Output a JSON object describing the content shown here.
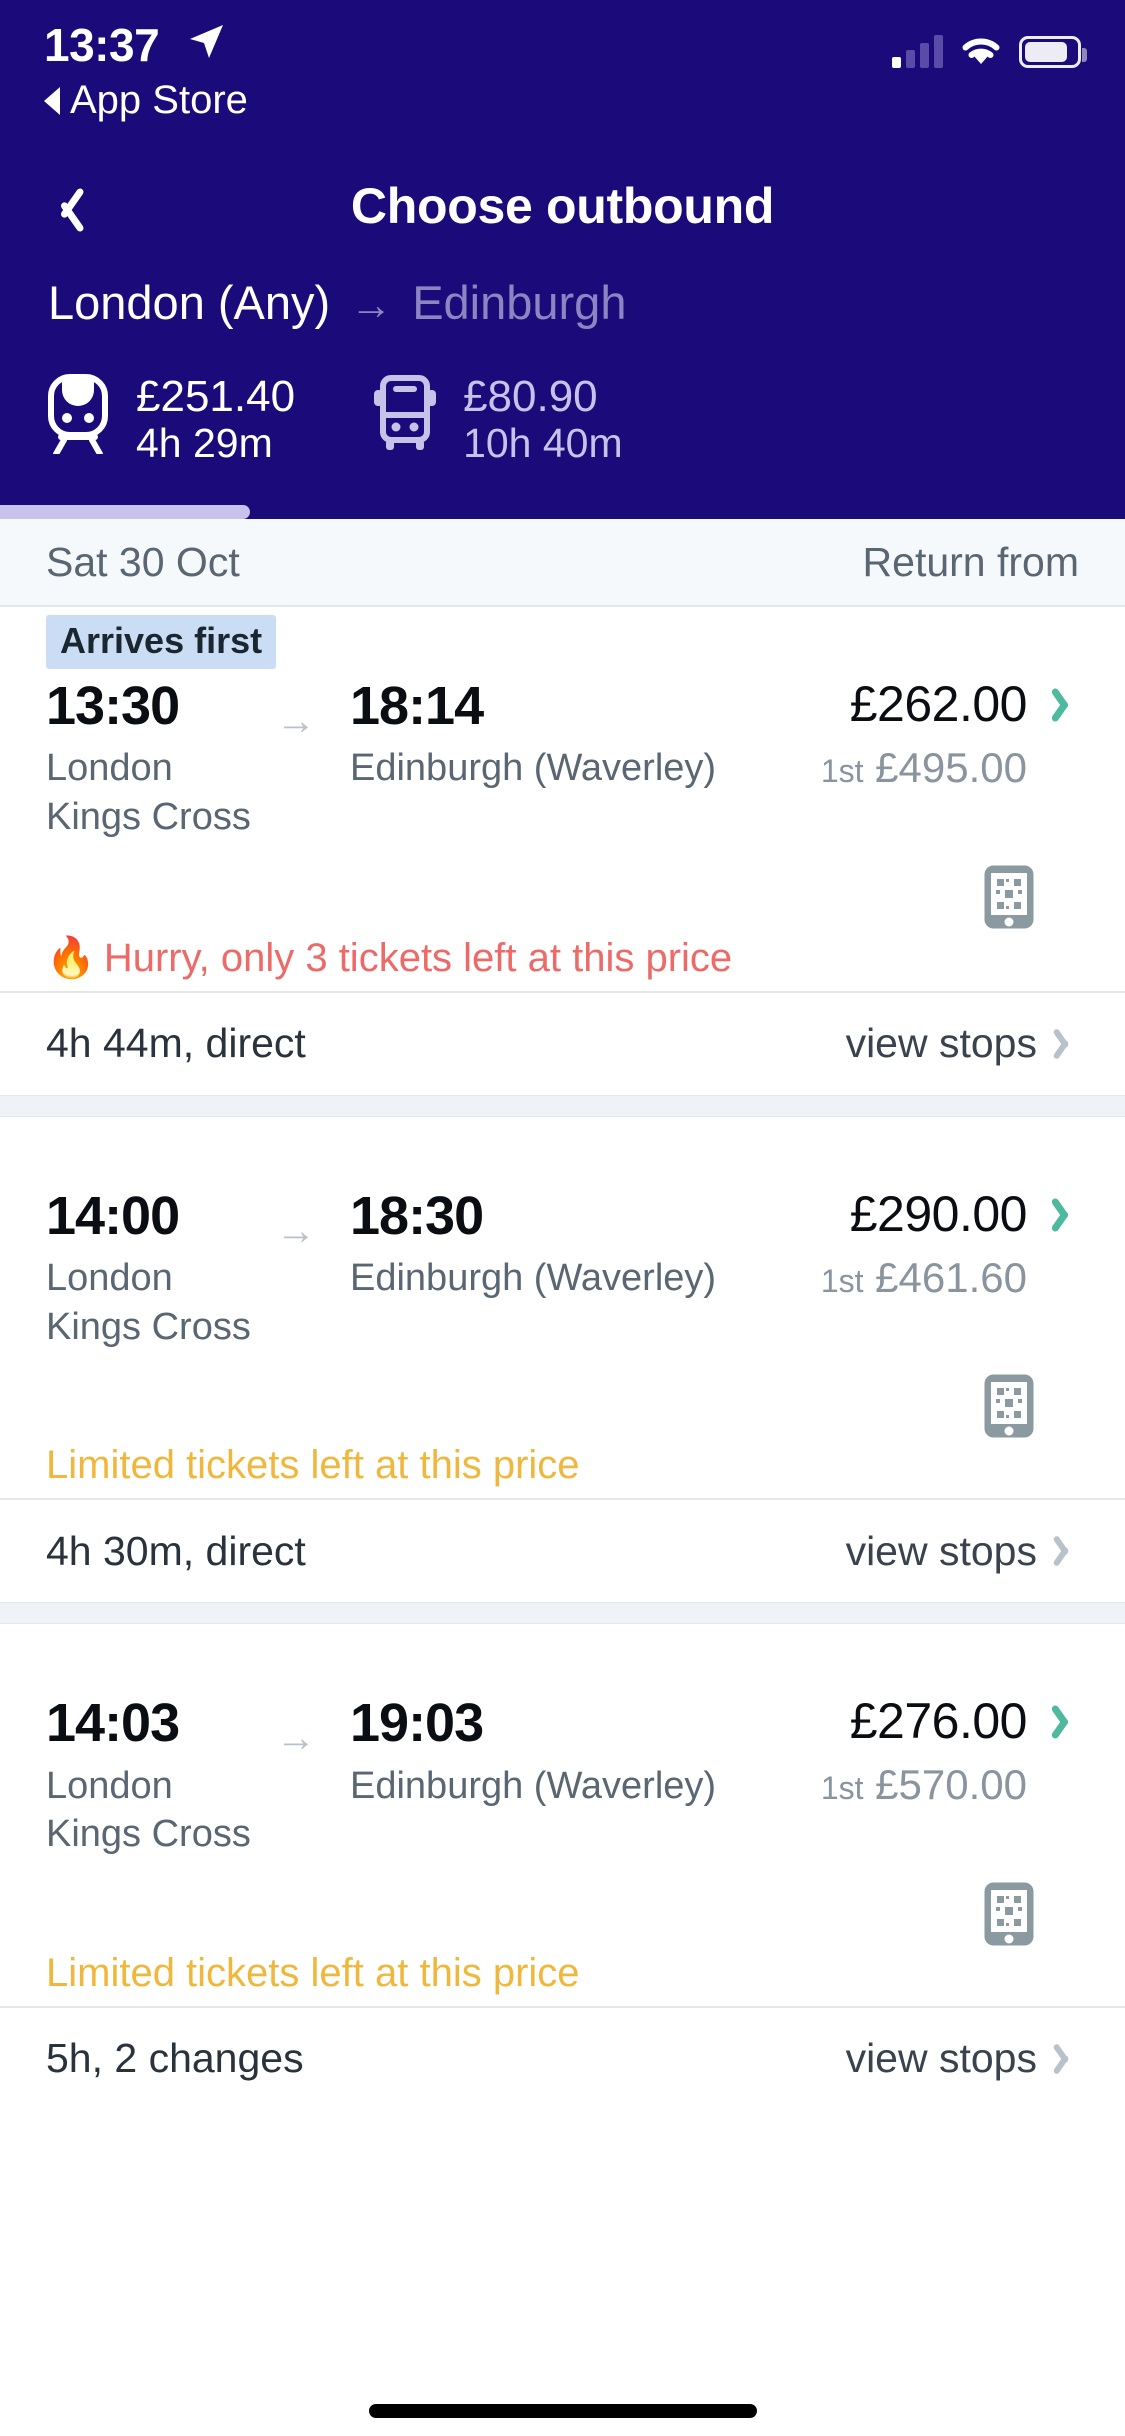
{
  "status_bar": {
    "time": "13:37",
    "back_app_label": "App Store",
    "location_icon": "location-arrow-icon",
    "signal_icon": "cellular-signal-icon",
    "wifi_icon": "wifi-icon",
    "battery_icon": "battery-icon"
  },
  "nav": {
    "back_icon": "chevron-left-icon",
    "title": "Choose outbound"
  },
  "route": {
    "from": "London (Any)",
    "arrow": "→",
    "to": "Edinburgh"
  },
  "modes": [
    {
      "icon": "train-icon",
      "price": "£251.40",
      "duration": "4h 29m",
      "active": true
    },
    {
      "icon": "bus-icon",
      "price": "£80.90",
      "duration": "10h 40m",
      "active": false
    }
  ],
  "date_bar": {
    "date": "Sat 30 Oct",
    "return_label": "Return from"
  },
  "journeys": [
    {
      "badge": "Arrives first",
      "depart_time": "13:30",
      "depart_station": "London Kings Cross",
      "arrow": "→",
      "arrive_time": "18:14",
      "arrive_station": "Edinburgh (Waverley)",
      "price": "£262.00",
      "first_class_label": "1st",
      "first_class_price": "£495.00",
      "ticket_icon": "mobile-ticket-icon",
      "alert_text": "Hurry, only 3 tickets left at this price",
      "alert_type": "hurry",
      "alert_icon": "🔥",
      "duration": "4h 44m, direct",
      "stops_label": "view stops"
    },
    {
      "badge": "",
      "depart_time": "14:00",
      "depart_station": "London Kings Cross",
      "arrow": "→",
      "arrive_time": "18:30",
      "arrive_station": "Edinburgh (Waverley)",
      "price": "£290.00",
      "first_class_label": "1st",
      "first_class_price": "£461.60",
      "ticket_icon": "mobile-ticket-icon",
      "alert_text": "Limited tickets left at this price",
      "alert_type": "limited",
      "alert_icon": "",
      "duration": "4h 30m, direct",
      "stops_label": "view stops"
    },
    {
      "badge": "",
      "depart_time": "14:03",
      "depart_station": "London Kings Cross",
      "arrow": "→",
      "arrive_time": "19:03",
      "arrive_station": "Edinburgh (Waverley)",
      "price": "£276.00",
      "first_class_label": "1st",
      "first_class_price": "£570.00",
      "ticket_icon": "mobile-ticket-icon",
      "alert_text": "Limited tickets left at this price",
      "alert_type": "limited",
      "alert_icon": "",
      "duration": "5h, 2 changes",
      "stops_label": "view stops"
    }
  ],
  "colors": {
    "header_bg": "#1B0B7A",
    "accent_chevron": "#4FB99F",
    "badge_bg": "#CBDDF5",
    "alert_hurry": "#EC6A68",
    "alert_limited": "#F0B73D",
    "muted_text": "#5A6672"
  }
}
